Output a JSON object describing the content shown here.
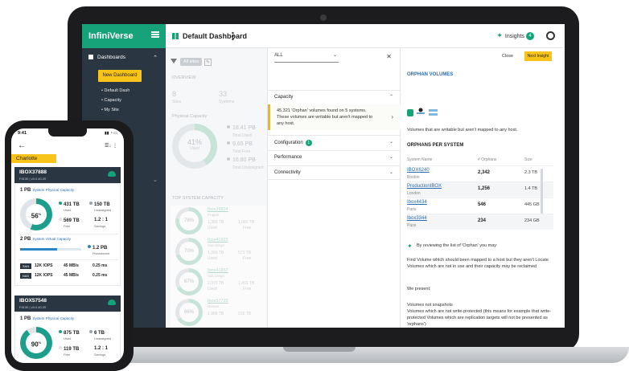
{
  "laptop": {
    "brand": "InfiniVerse",
    "dashboard_title": "Default Dashboard",
    "insights_label": "Insights",
    "insights_count": "4",
    "sidebar": {
      "dashboards_label": "Dashboards",
      "new_dash_button": "New Dashboard",
      "subnav": [
        "Default Dash",
        "Capacity",
        "My Site"
      ]
    },
    "main": {
      "filter_chip": "All sites",
      "overview_label": "OVERVIEW",
      "sites_value": "8",
      "sites_label": "Sites",
      "systems_value": "33",
      "systems_label": "Systems",
      "physical_capacity_label": "Physical Capacity",
      "donut_pct": "41%",
      "donut_label": "Used",
      "total_used_value": "18.41 PB",
      "total_used_label": "Total Used",
      "total_free_value": "9.65 PB",
      "total_free_label": "Total Free",
      "total_unassigned_value": "16.80 PB",
      "total_unassigned_label": "Total Unassigned",
      "top_capacity_label": "TOP SYSTEM CAPACITY",
      "systems": [
        {
          "pct": "78%",
          "name": "Ibox29824",
          "loc": "Prague",
          "a": "1,383 TB",
          "b": "1,080 TB",
          "a_l": "Used",
          "b_l": "Free"
        },
        {
          "pct": "70%",
          "name": "Ibox41826",
          "loc": "San Diego",
          "a": "1,393 TB",
          "b": "573 TB",
          "a_l": "Used",
          "b_l": "Free"
        },
        {
          "pct": "67%",
          "name": "Ibox41857",
          "loc": "San Diego",
          "a": "2,075 TB",
          "b": "1,401 TB",
          "a_l": "Used",
          "b_l": "Free"
        },
        {
          "pct": "66%",
          "name": "Ibox57733",
          "loc": "Denver",
          "a": "1,988 TB",
          "b": "915 TB",
          "a_l": "Used",
          "b_l": "Free"
        }
      ]
    },
    "filter_panel": {
      "select_value": "ALL",
      "sections": [
        "Capacity",
        "Configuration",
        "Performance",
        "Connectivity"
      ],
      "config_badge": "1",
      "alert_text": "45,321 'Orphan' volumes found on 5 systems. These volumes are writable but aren't mapped to any host."
    },
    "insight_panel": {
      "close_label": "Close",
      "next_label": "Next Insight",
      "heading": "ORPHAN VOLUMES",
      "description": "Volumes that are writable but aren't mapped to any host.",
      "per_system_heading": "ORPHANS PER SYSTEM",
      "col_name": "System Name",
      "col_orphans": "# Orphans",
      "col_size": "Size",
      "rows": [
        {
          "name": "IBOX6240",
          "loc": "Boston",
          "orphans": "2,342",
          "size": "2.3 TB"
        },
        {
          "name": "ProductionIBOX",
          "loc": "London",
          "orphans": "1,256",
          "size": "1.4 TB"
        },
        {
          "name": "Ibox4434",
          "loc": "Paris",
          "orphans": "546",
          "size": "445 GB"
        },
        {
          "name": "Ibox3344",
          "loc": "Paris",
          "orphans": "234",
          "size": "234 GB"
        }
      ],
      "tip": "By reviewing the list of 'Orphan' you may:",
      "para1": "Find Volume which should been mapped to a host but they aren't Locate Volumes which are not in use and their capacity may be reclaimed",
      "para2": "We present:",
      "para3": "Volumes not snapshots",
      "para4": "Volumes which are not write-protected (this means for example that write-protected Volumes which are replication targets will not be presented as 'orphans')"
    }
  },
  "phone": {
    "time": "9:41",
    "site": "Charlotte",
    "cards": [
      {
        "title": "IBOX37888",
        "subtitle": "F4130 | v3.0.40.20",
        "physical_pb": "1 PB",
        "physical_label": "System Physical Capacity",
        "pct": "56",
        "used": "431 TB",
        "used_l": "Used",
        "unassigned": "150 TB",
        "unassigned_l": "Unassigned",
        "free": "569 TB",
        "free_l": "Free",
        "savings": "1.2 : 1",
        "savings_l": "Savings",
        "virtual_pb": "2 PB",
        "virtual_label": "System Virtual Capacity",
        "provisioned": "1.2 PB",
        "provisioned_l": "Provisioned",
        "virtual_fill": 0.6,
        "san_tag": "SAN",
        "nas_tag": "NAS",
        "san_iops": "12K IOPS",
        "nas_iops": "12K IOPS",
        "san_mbs": "45 MB/s",
        "nas_mbs": "45 MB/s",
        "san_ms": "0.25 ms",
        "nas_ms": "0.25 ms"
      },
      {
        "title": "IBOX57548",
        "subtitle": "F4130 | v3.0.40.20",
        "physical_pb": "1 PB",
        "physical_label": "System Physical Capacity",
        "pct": "90",
        "used": "875 TB",
        "used_l": "Used",
        "unassigned": "6 TB",
        "unassigned_l": "Unassigned",
        "free": "119 TB",
        "free_l": "Free",
        "savings": "1.2 : 1",
        "savings_l": "Savings"
      }
    ]
  }
}
